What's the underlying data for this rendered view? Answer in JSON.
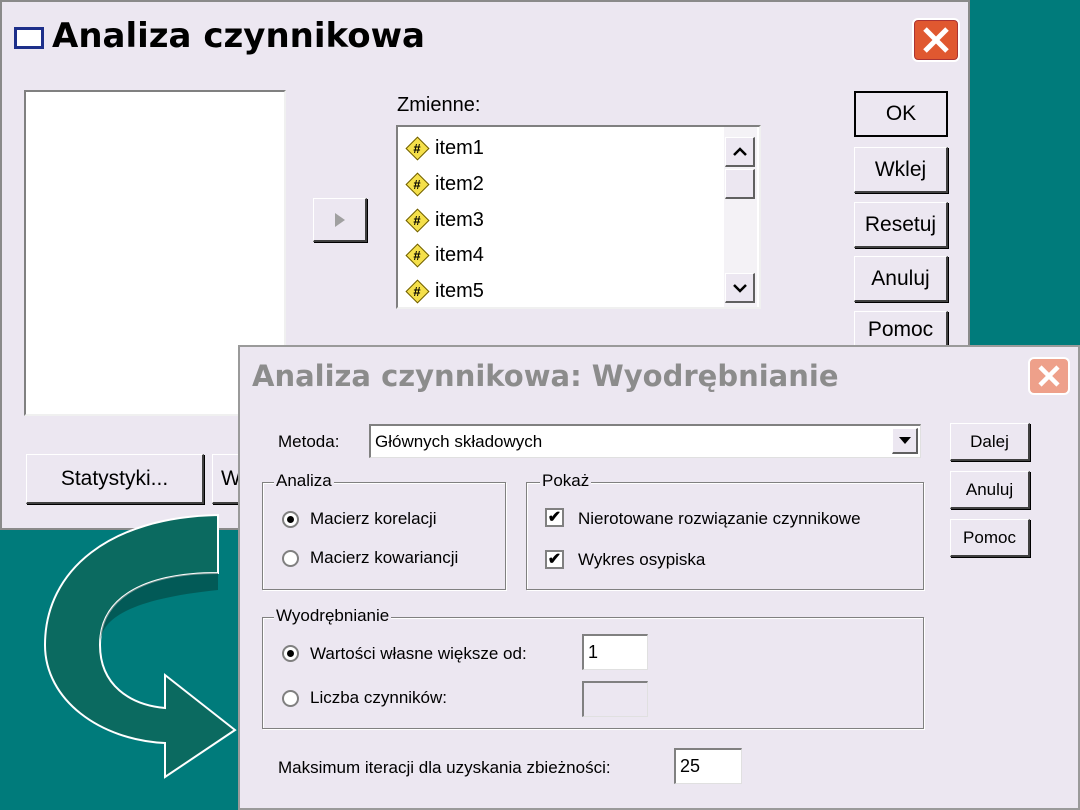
{
  "main_dialog": {
    "title": "Analiza czynnikowa",
    "variables_label": "Zmienne:",
    "variables": [
      "item1",
      "item2",
      "item3",
      "item4",
      "item5"
    ],
    "buttons": {
      "ok": "OK",
      "paste": "Wklej",
      "reset": "Resetuj",
      "cancel": "Anuluj",
      "help": "Pomoc",
      "statistics": "Statystyki...",
      "partial": "W"
    }
  },
  "sub_dialog": {
    "title": "Analiza czynnikowa: Wyodrębnianie",
    "method_label": "Metoda:",
    "method_value": "Głównych składowych",
    "buttons": {
      "continue": "Dalej",
      "cancel": "Anuluj",
      "help": "Pomoc"
    },
    "analysis": {
      "title": "Analiza",
      "options": [
        "Macierz korelacji",
        "Macierz kowariancji"
      ],
      "selected_index": 0
    },
    "display": {
      "title": "Pokaż",
      "options": [
        {
          "label": "Nierotowane rozwiązanie czynnikowe",
          "checked": true
        },
        {
          "label": "Wykres osypiska",
          "checked": true
        }
      ]
    },
    "extract": {
      "title": "Wyodrębnianie",
      "eigen_label": "Wartości własne większe od:",
      "eigen_value": "1",
      "factors_label": "Liczba czynników:",
      "factors_value": "",
      "selected_index": 0
    },
    "iterations_label": "Maksimum iteracji dla uzyskania zbieżności:",
    "iterations_value": "25"
  },
  "colors": {
    "background": "#007b7b",
    "dialog": "#ece7f1",
    "close_button": "#e05830",
    "arrow": "#0b6a60"
  }
}
